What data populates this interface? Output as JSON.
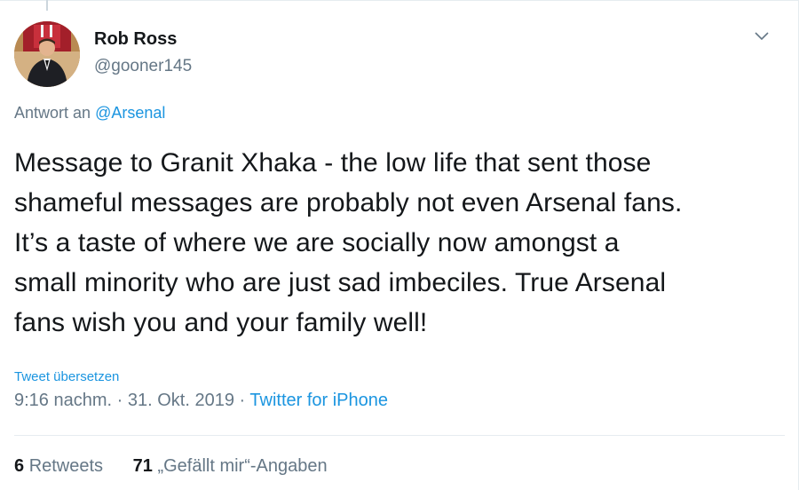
{
  "tweet": {
    "author_name": "Rob Ross",
    "author_handle": "@gooner145",
    "reply_prefix": "Antwort an",
    "reply_to": "@Arsenal",
    "text_lines": [
      "Message to Granit Xhaka - the low life that sent those",
      "shameful messages are probably not even Arsenal fans.",
      "It’s a taste of where we are socially now amongst a",
      "small minority who are just sad imbeciles. True Arsenal",
      "fans wish you and your family well!"
    ],
    "translate_label": "Tweet übersetzen",
    "time": "9:16 nachm.",
    "separator": "·",
    "date": "31. Okt. 2019",
    "source": "Twitter for iPhone",
    "retweets_count": "6",
    "retweets_label": "Retweets",
    "likes_count": "71",
    "likes_label": "„Gefällt mir“-Angaben"
  },
  "icons": {
    "menu": "chevron-down-icon",
    "avatar": "avatar"
  },
  "colors": {
    "link": "#1b95e0",
    "secondary_text": "#657786",
    "primary_text": "#14171a",
    "border": "#e6ecf0"
  }
}
